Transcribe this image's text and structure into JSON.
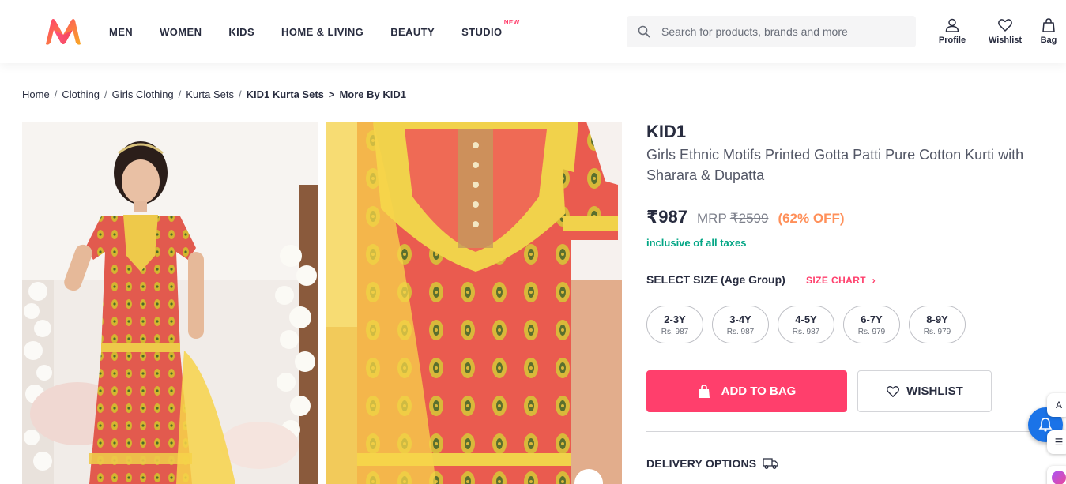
{
  "header": {
    "logo": "myntra-logo",
    "nav": [
      {
        "label": "MEN"
      },
      {
        "label": "WOMEN"
      },
      {
        "label": "KIDS"
      },
      {
        "label": "HOME & LIVING"
      },
      {
        "label": "BEAUTY"
      },
      {
        "label": "STUDIO",
        "badge": "NEW"
      }
    ],
    "search_placeholder": "Search for products, brands and more",
    "actions": {
      "profile": "Profile",
      "wishlist": "Wishlist",
      "bag": "Bag"
    }
  },
  "breadcrumb": [
    {
      "label": "Home"
    },
    {
      "label": "Clothing"
    },
    {
      "label": "Girls Clothing"
    },
    {
      "label": "Kurta Sets"
    },
    {
      "label": "KID1 Kurta Sets"
    },
    {
      "label": "More By KID1"
    }
  ],
  "product": {
    "brand": "KID1",
    "title": "Girls Ethnic Motifs Printed Gotta Patti Pure Cotton Kurti with Sharara & Dupatta",
    "price": "₹987",
    "mrp_label": "MRP",
    "mrp": "₹2599",
    "discount": "(62% OFF)",
    "tax_note": "inclusive of all taxes",
    "size_title": "SELECT SIZE (Age Group)",
    "size_chart": "SIZE CHART",
    "sizes": [
      {
        "label": "2-3Y",
        "price": "Rs. 987"
      },
      {
        "label": "3-4Y",
        "price": "Rs. 987"
      },
      {
        "label": "4-5Y",
        "price": "Rs. 987"
      },
      {
        "label": "6-7Y",
        "price": "Rs. 979"
      },
      {
        "label": "8-9Y",
        "price": "Rs. 979"
      }
    ],
    "add_to_bag": "ADD TO BAG",
    "wishlist": "WISHLIST",
    "delivery_title": "DELIVERY OPTIONS"
  },
  "colors": {
    "accent": "#ff3f6c",
    "discount": "#ff905a",
    "tax_green": "#03a685",
    "text": "#282c3f",
    "kurta_red": "#e8524f",
    "kurta_yellow": "#f4d23c"
  }
}
